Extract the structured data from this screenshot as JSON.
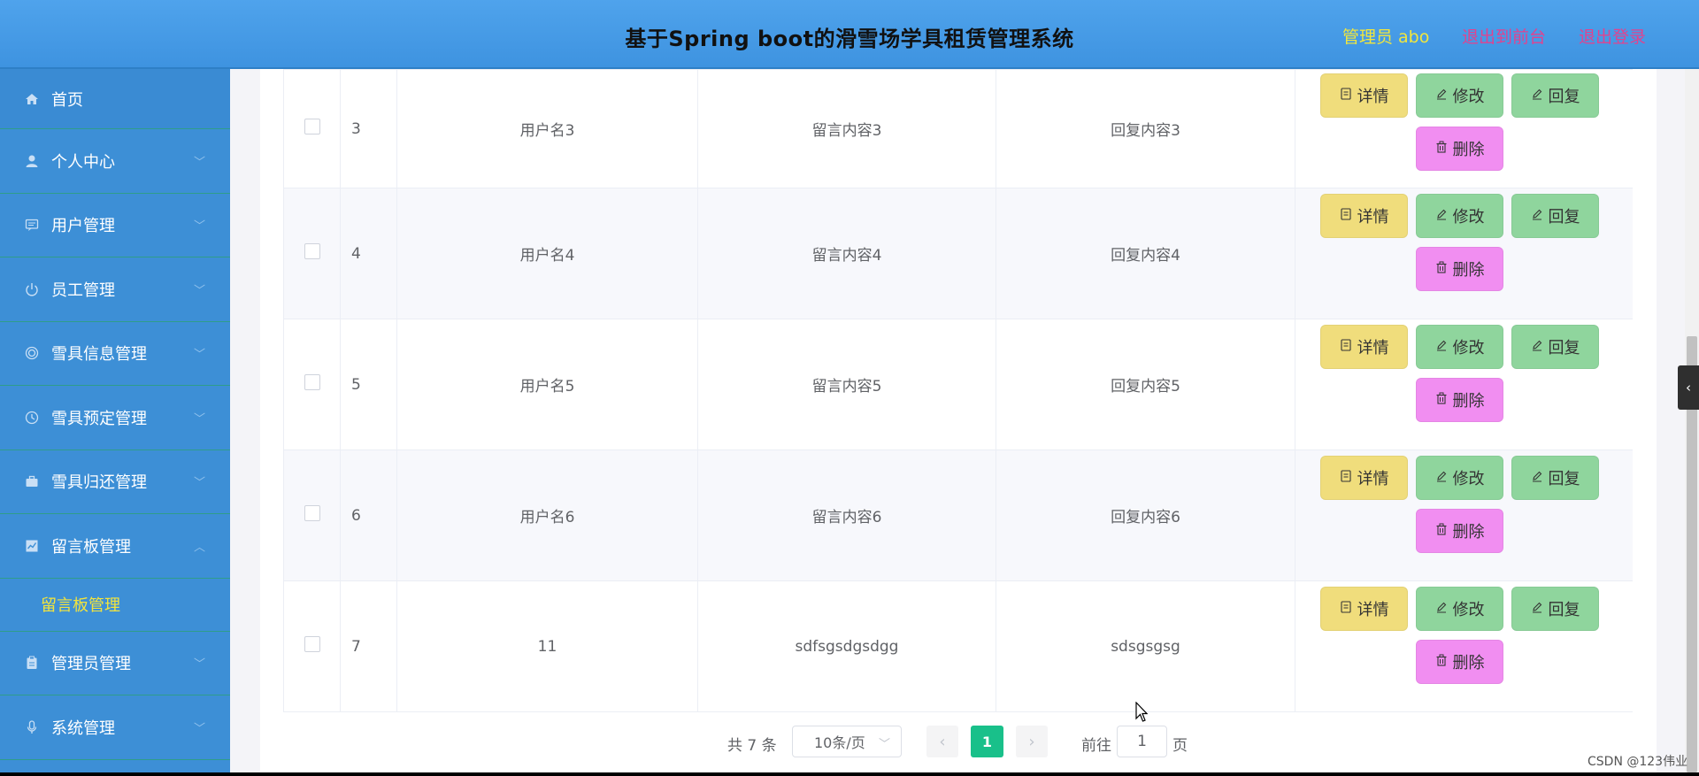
{
  "header": {
    "title": "基于Spring boot的滑雪场学具租赁管理系统",
    "admin": "管理员 abo",
    "exit_front": "退出到前台",
    "logout": "退出登录"
  },
  "sidebar": {
    "items": [
      {
        "label": "首页",
        "icon": "home-icon"
      },
      {
        "label": "个人中心",
        "icon": "user-icon"
      },
      {
        "label": "用户管理",
        "icon": "message-icon"
      },
      {
        "label": "员工管理",
        "icon": "power-icon"
      },
      {
        "label": "雪具信息管理",
        "icon": "target-icon"
      },
      {
        "label": "雪具预定管理",
        "icon": "clock-icon"
      },
      {
        "label": "雪具归还管理",
        "icon": "briefcase-icon"
      },
      {
        "label": "留言板管理",
        "icon": "chart-icon"
      },
      {
        "label": "管理员管理",
        "icon": "clipboard-icon"
      },
      {
        "label": "系统管理",
        "icon": "mic-icon"
      }
    ],
    "sub_item": "留言板管理"
  },
  "table": {
    "rows": [
      {
        "index": "3",
        "user": "用户名3",
        "message": "留言内容3",
        "reply": "回复内容3"
      },
      {
        "index": "4",
        "user": "用户名4",
        "message": "留言内容4",
        "reply": "回复内容4"
      },
      {
        "index": "5",
        "user": "用户名5",
        "message": "留言内容5",
        "reply": "回复内容5"
      },
      {
        "index": "6",
        "user": "用户名6",
        "message": "留言内容6",
        "reply": "回复内容6"
      },
      {
        "index": "7",
        "user": "11",
        "message": "sdfsgsdgsdgg",
        "reply": "sdsgsgsg"
      }
    ],
    "actions": {
      "detail": "详情",
      "edit": "修改",
      "reply": "回复",
      "delete": "删除"
    }
  },
  "pagination": {
    "total": "共 7 条",
    "page_size": "10条/页",
    "current_page": "1",
    "goto_label": "前往",
    "goto_value": "1",
    "page_unit": "页"
  },
  "watermark": "CSDN @123伟业",
  "colors": {
    "header_bg": "#4fa3ec",
    "sidebar_bg": "#3d8fd6",
    "active_sub": "#f3e43c",
    "btn_detail": "#f0dd7c",
    "btn_edit": "#8fd59d",
    "btn_delete": "#f18ef1",
    "page_active": "#19c08a"
  }
}
